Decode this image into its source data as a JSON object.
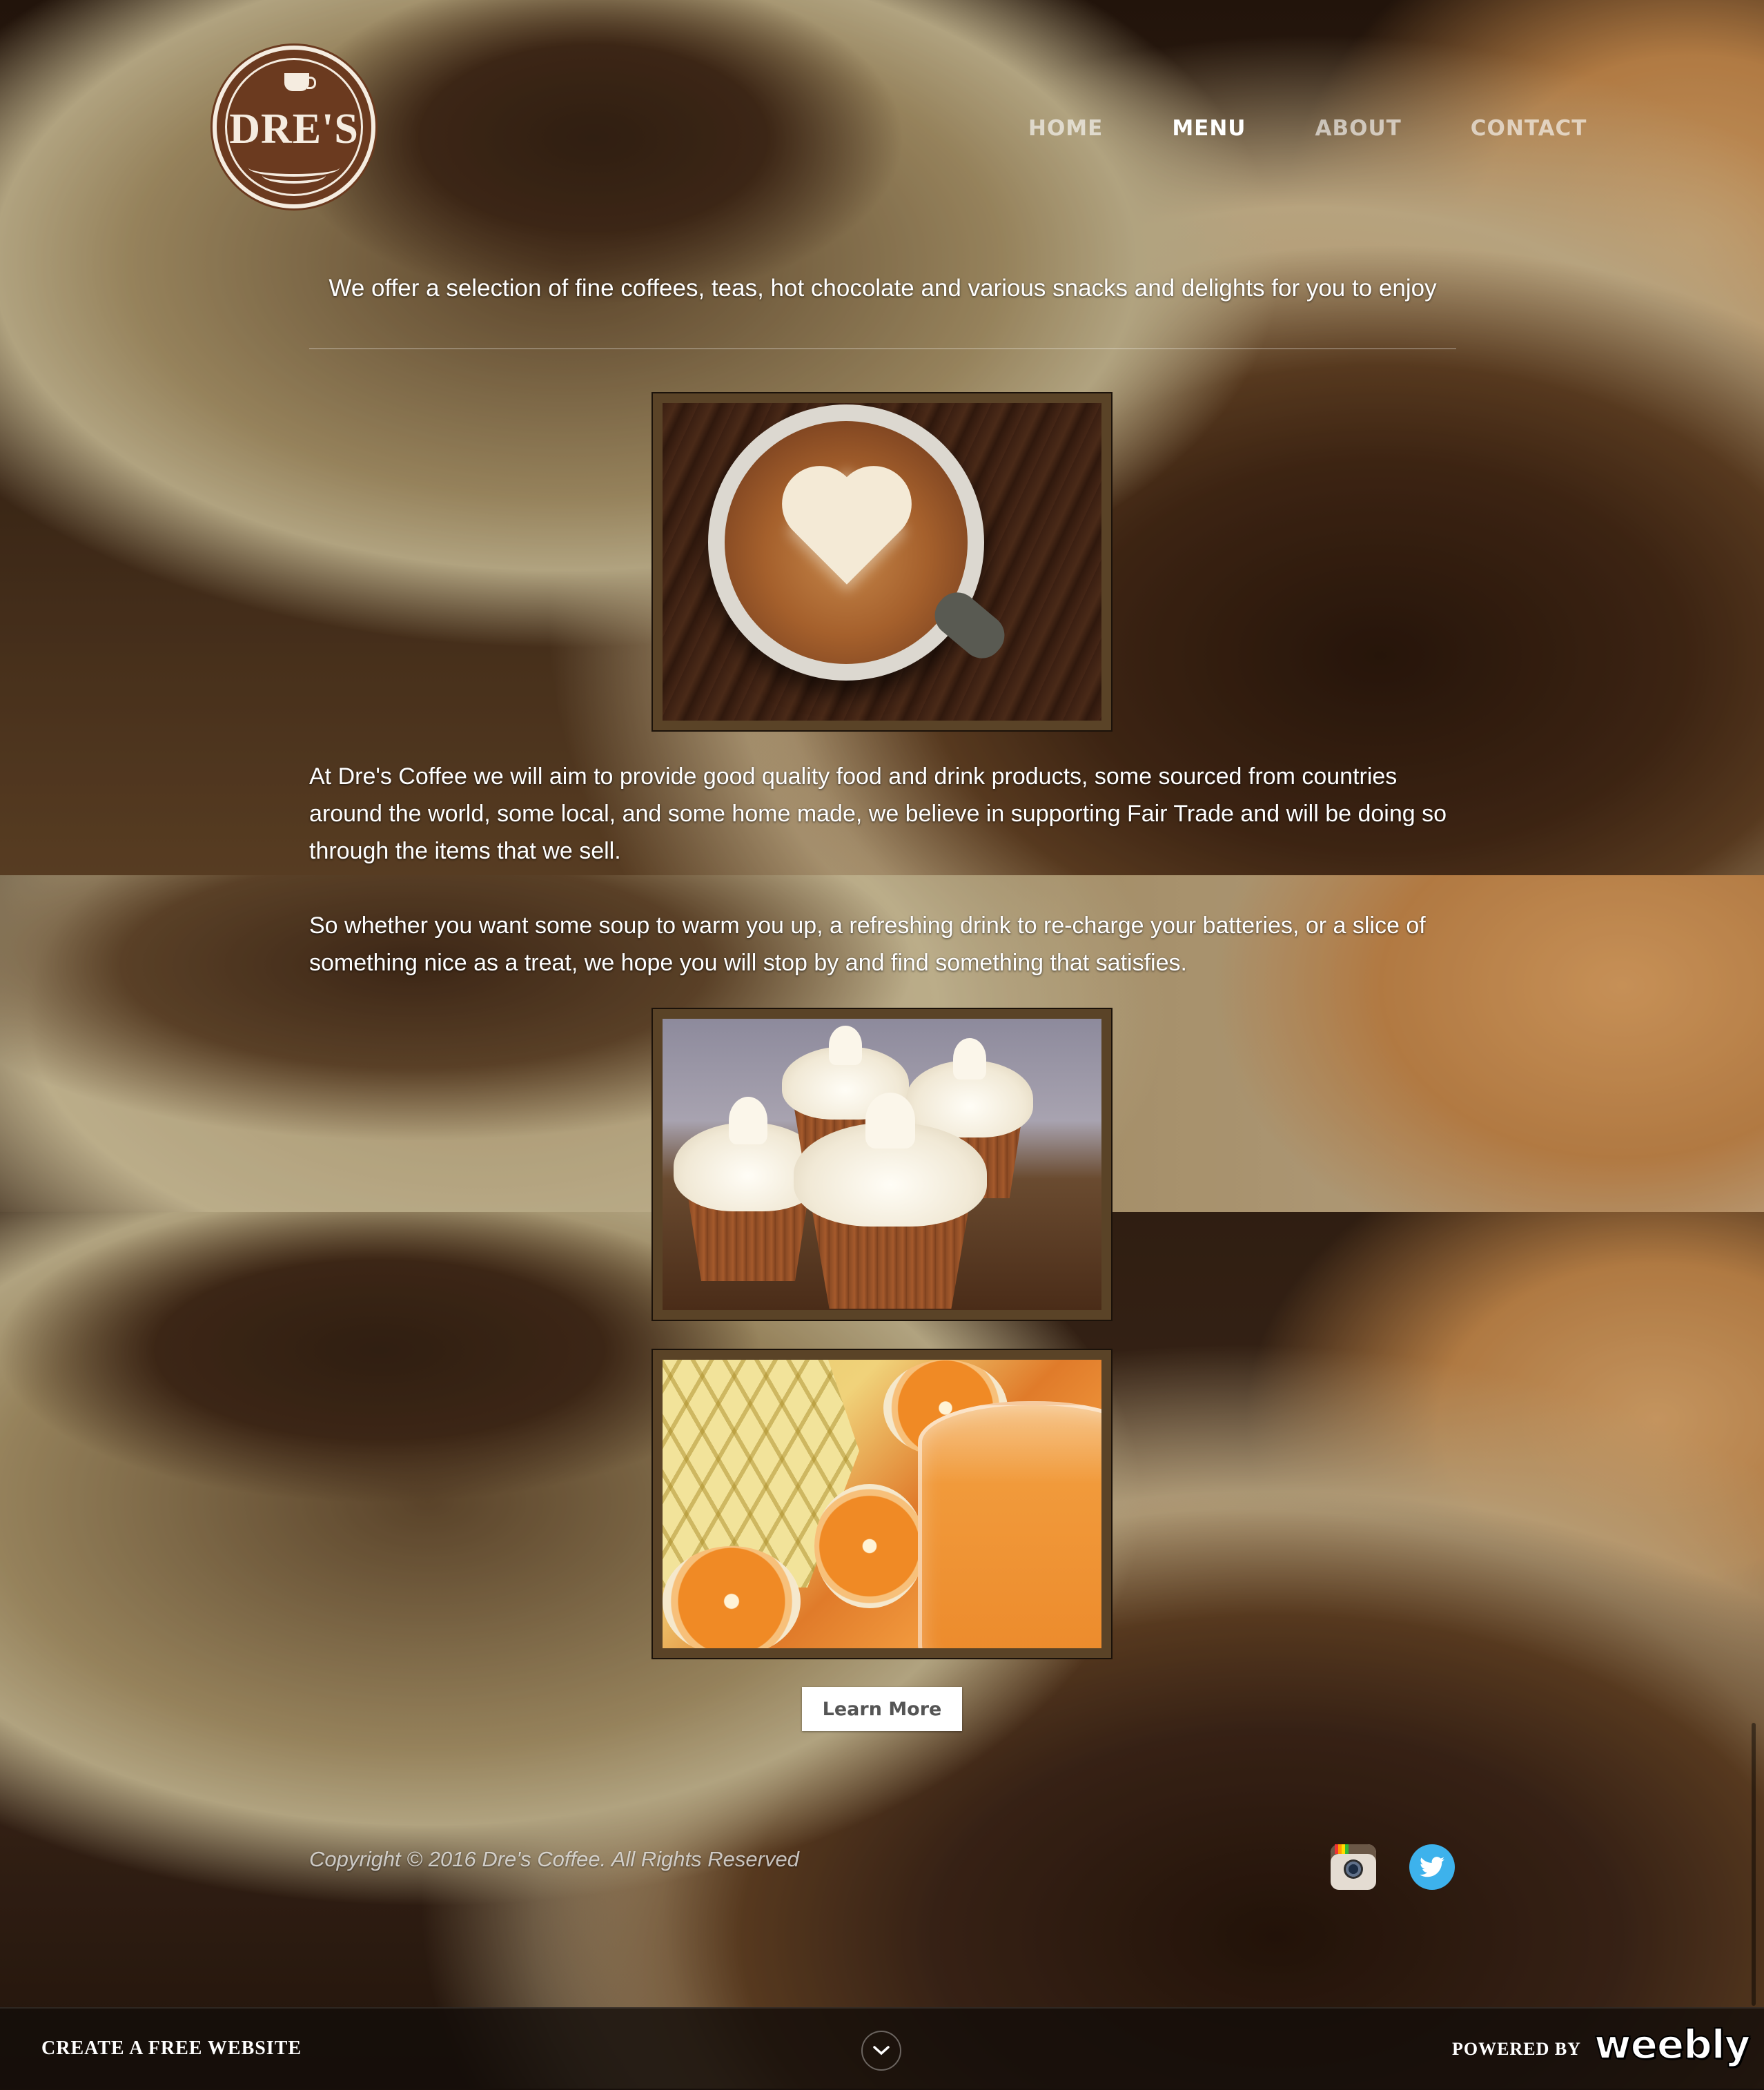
{
  "logo": {
    "text": "DRE'S"
  },
  "nav": {
    "items": [
      {
        "label": "HOME"
      },
      {
        "label": "MENU",
        "active": true
      },
      {
        "label": "ABOUT"
      },
      {
        "label": "CONTACT"
      }
    ]
  },
  "main": {
    "intro": "We offer a selection of fine coffees, teas, hot chocolate and various snacks and delights for you to enjoy",
    "paragraph_1": "At Dre's Coffee we will aim to provide good quality food and drink products, some sourced from countries around the world, some local, and some home made, we believe in supporting Fair Trade and will be doing so through the items that we sell.",
    "paragraph_2": "So whether you want some soup to warm you up, a refreshing drink to re-charge your batteries, or a slice of something nice as a treat, we hope you will stop by and find something that satisfies.",
    "learn_more_label": "Learn More"
  },
  "footer": {
    "copyright": "Copyright © 2016 Dre's Coffee. All Rights Reserved",
    "social": [
      "instagram-icon",
      "twitter-icon"
    ]
  },
  "weebly_bar": {
    "create_label": "CREATE A FREE WEBSITE",
    "powered_label": "POWERED BY",
    "brand": "weebly"
  },
  "colors": {
    "button_bg": "#ffffff",
    "button_text": "#555555",
    "nav_active": "#ffffff",
    "twitter_blue": "#3db2ec",
    "logo_brown": "#6b3a1f"
  }
}
